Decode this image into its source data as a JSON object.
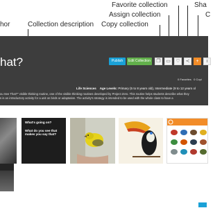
{
  "callouts": {
    "author": "hor",
    "collection_description": "Collection description",
    "favorite_collection": "Favorite collection",
    "assign_collection": "Assign collection",
    "copy_collection": "Copy collection",
    "share_partial": "Sha",
    "c_partial": "C"
  },
  "header": {
    "title": "hat?"
  },
  "toolbar": {
    "publish_label": "Publish",
    "edit_label": "Edit Collection",
    "icons": [
      "copy-icon",
      "assign-folder-icon",
      "favorite-heart-icon",
      "share-icon",
      "plus-icon",
      "info-icon"
    ]
  },
  "stats": {
    "favorites": "0 Favorites",
    "copies": "0 Copi"
  },
  "meta": {
    "subject": "Life Sciences",
    "age_levels_label": "Age Levels:",
    "age_levels_value": "Primary (5 to 8 years old), Intermediate (9 to 12 years ol"
  },
  "description": {
    "line1": "ou See That?\" visible thinking routine, one of the visible thinking routines developed by Project Zero. This routine helps students describe what they",
    "line2": "s is an introductory activity for a unit on birds or adaptation. The activity's strategy is intended to be used with the whole class to have a"
  },
  "cards": {
    "question_card": {
      "q1": "What's going on?",
      "q2": "What do you see that makes you say that?"
    }
  },
  "colors": {
    "header_bg": "#3d3d3d",
    "publish_button": "#1aa1d7",
    "edit_button": "#62b04b",
    "accent_orange": "#f28c28"
  }
}
